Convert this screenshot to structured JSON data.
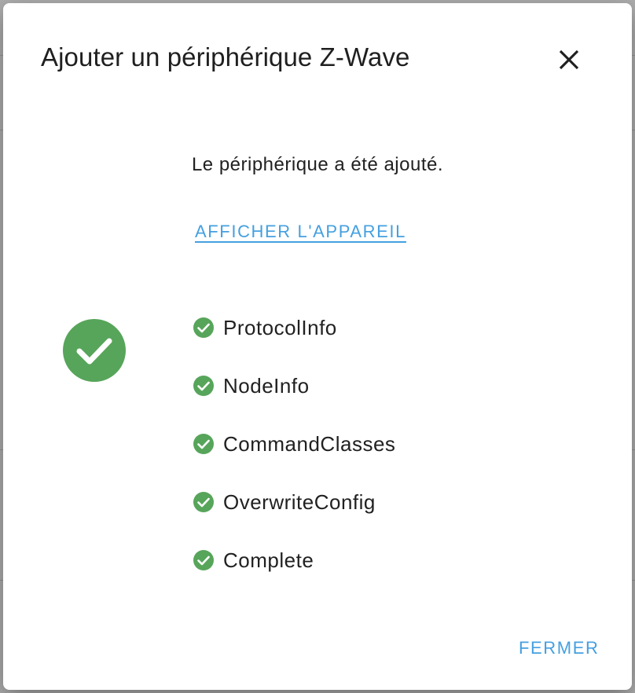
{
  "dialog": {
    "title": "Ajouter un périphérique Z-Wave",
    "status_message": "Le périphérique a été ajouté.",
    "view_device_label": "AFFICHER L'APPAREIL",
    "close_button_label": "FERMER",
    "success_icon": "check-circle-icon",
    "close_icon": "close-icon"
  },
  "steps": [
    {
      "label": "ProtocolInfo",
      "status": "done",
      "icon": "check-circle-icon"
    },
    {
      "label": "NodeInfo",
      "status": "done",
      "icon": "check-circle-icon"
    },
    {
      "label": "CommandClasses",
      "status": "done",
      "icon": "check-circle-icon"
    },
    {
      "label": "OverwriteConfig",
      "status": "done",
      "icon": "check-circle-icon"
    },
    {
      "label": "Complete",
      "status": "done",
      "icon": "check-circle-icon"
    }
  ],
  "colors": {
    "success": "#57a55a",
    "accent": "#45a0e0",
    "text": "#212121"
  }
}
